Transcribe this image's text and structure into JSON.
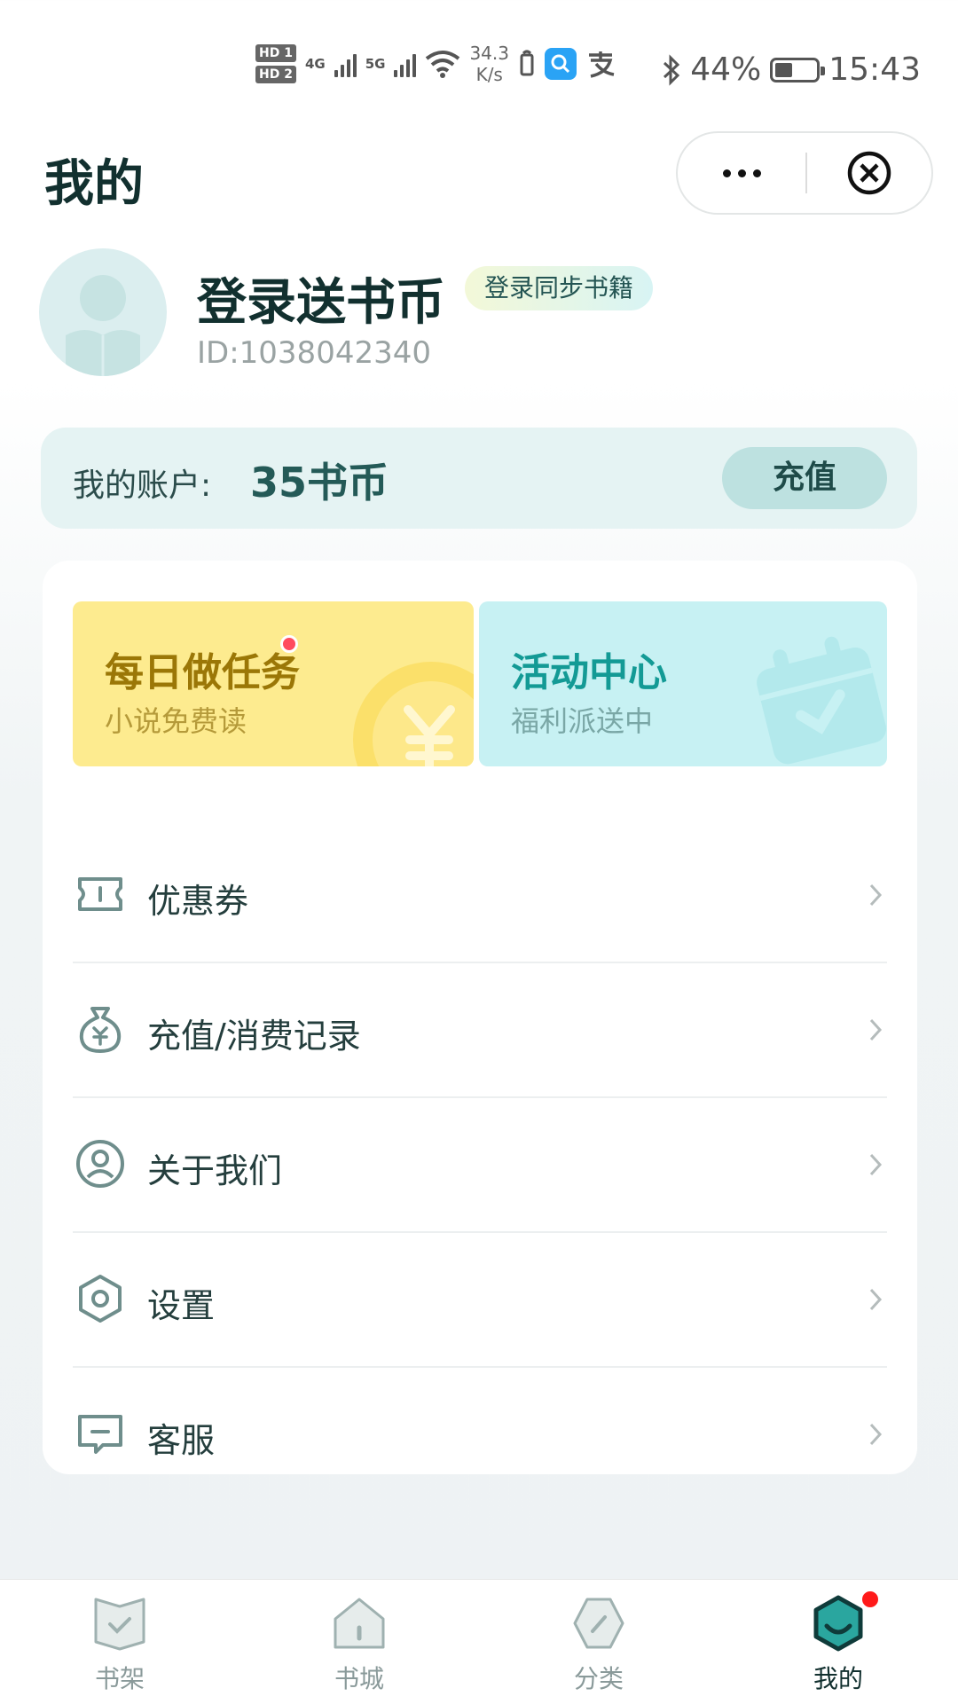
{
  "status_bar": {
    "hd1": "HD 1",
    "hd2": "HD 2",
    "net1": "4G",
    "net2": "5G",
    "speed_value": "34.3",
    "speed_unit": "K/s",
    "battery_percent": "44%",
    "battery_level": 0.44,
    "time": "15:43"
  },
  "header": {
    "title": "我的"
  },
  "profile": {
    "login_title": "登录送书币",
    "sync_badge": "登录同步书籍",
    "user_id": "ID:1038042340"
  },
  "account": {
    "label": "我的账户:",
    "balance": "35书币",
    "recharge_button": "充值"
  },
  "promos": {
    "task": {
      "title": "每日做任务",
      "subtitle": "小说免费读"
    },
    "activity": {
      "title": "活动中心",
      "subtitle": "福利派送中"
    }
  },
  "menu": [
    {
      "label": "优惠券",
      "icon": "coupon-icon"
    },
    {
      "label": "充值/消费记录",
      "icon": "money-bag-icon"
    },
    {
      "label": "关于我们",
      "icon": "user-circle-icon"
    },
    {
      "label": "设置",
      "icon": "settings-hexagon-icon"
    },
    {
      "label": "客服",
      "icon": "chat-icon"
    }
  ],
  "tabs": [
    {
      "label": "书架",
      "icon": "bookshelf-icon"
    },
    {
      "label": "书城",
      "icon": "home-icon"
    },
    {
      "label": "分类",
      "icon": "category-icon"
    },
    {
      "label": "我的",
      "icon": "profile-smile-icon",
      "active": true
    }
  ],
  "colors": {
    "primary_dark": "#12302f",
    "accent_teal": "#139a95",
    "task_yellow": "#fdeb8f",
    "activity_cyan": "#c7f1f3",
    "badge_red": "#ff4b5e"
  }
}
